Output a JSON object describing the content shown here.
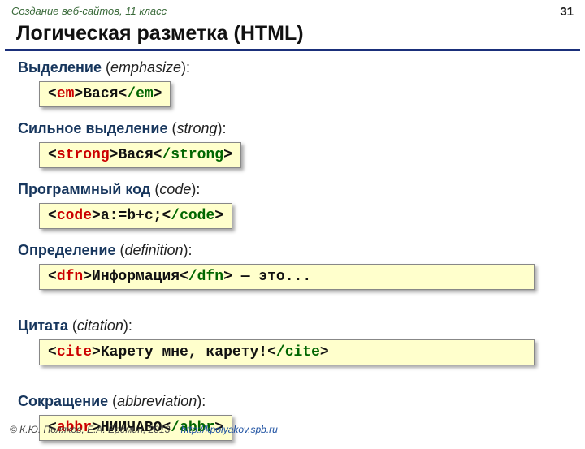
{
  "header": {
    "course": "Создание веб-сайтов, 11 класс",
    "page_number": "31"
  },
  "title": "Логическая разметка (HTML)",
  "sections": [
    {
      "heading_ru": "Выделение",
      "heading_en": "emphasize",
      "tag": "em",
      "content": "Вася",
      "after": "",
      "wide": false
    },
    {
      "heading_ru": "Сильное выделение",
      "heading_en": "strong",
      "tag": "strong",
      "content": "Вася",
      "after": "",
      "wide": false
    },
    {
      "heading_ru": "Программный код",
      "heading_en": "code",
      "tag": "code",
      "content": "a:=b+c;",
      "after": "",
      "wide": false
    },
    {
      "heading_ru": "Определение",
      "heading_en": "definition",
      "tag": "dfn",
      "content": "Информация",
      "after": " &mdash; это...",
      "wide": true
    },
    {
      "heading_ru": "Цитата",
      "heading_en": "citation",
      "tag": "cite",
      "content": "Карету мне, карету!",
      "after": "",
      "wide": true
    },
    {
      "heading_ru": "Сокращение",
      "heading_en": "abbreviation",
      "tag": "abbr",
      "content": "НИИЧАВО",
      "after": "",
      "wide": false
    }
  ],
  "footer": {
    "copyright": "© К.Ю. Поляков, Е.А. Ерёмин, 2013",
    "url": "http://kpolyakov.spb.ru"
  },
  "brackets": {
    "lt": "<",
    "gt": ">",
    "slash": "/"
  }
}
